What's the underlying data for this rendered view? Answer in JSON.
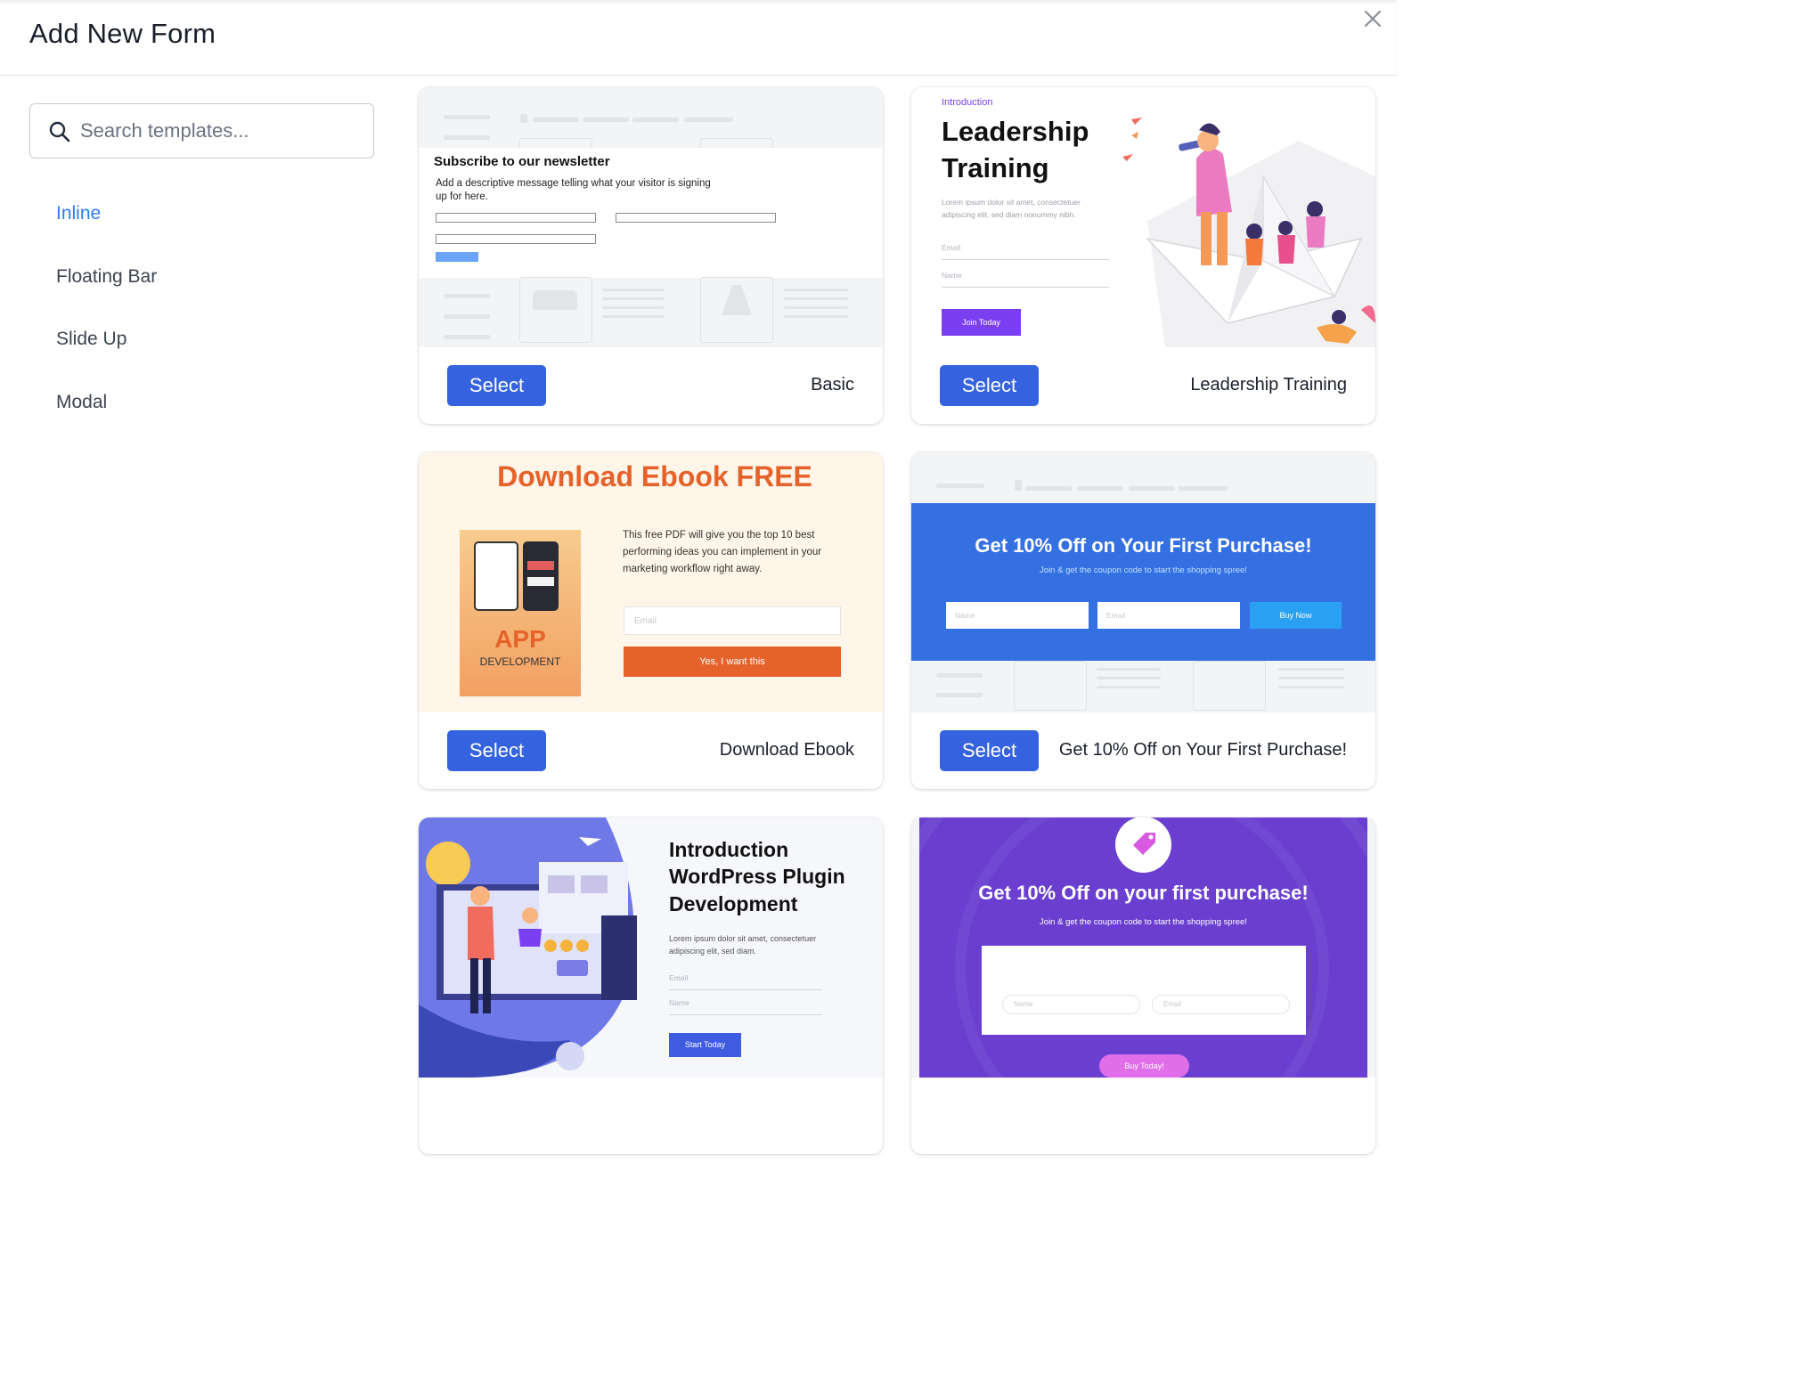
{
  "modal": {
    "title": "Add New Form",
    "close_label": "×"
  },
  "search": {
    "placeholder": "Search templates..."
  },
  "categories": [
    "Inline",
    "Floating Bar",
    "Slide Up",
    "Modal"
  ],
  "select_label": "Select",
  "templates": [
    {
      "name": "Basic",
      "preview": {
        "heading": "Subscribe to our newsletter",
        "message": "Add a descriptive message telling what your visitor is signing up for here."
      }
    },
    {
      "name": "Leadership Training",
      "preview": {
        "eyebrow": "Introduction",
        "heading_line1": "Leadership",
        "heading_line2": "Training",
        "body": "Lorem ipsum dolor sit amet, consectetuer adipiscing elit, sed diam nonummy nibh.",
        "email_label": "Email",
        "name_label": "Name",
        "button": "Join Today"
      }
    },
    {
      "name": "Download Ebook",
      "preview": {
        "heading": "Download Ebook FREE",
        "body": "This free PDF will give you the top 10 best performing ideas you can implement in your marketing workflow right away.",
        "email_placeholder": "Email",
        "button": "Yes, I want this",
        "book_title": "APP",
        "book_subtitle": "DEVELOPMENT"
      }
    },
    {
      "name": "Get 10% Off on Your First Purchase!",
      "preview": {
        "heading": "Get 10% Off on Your First Purchase!",
        "subheading": "Join & get the coupon code to start the shopping spree!",
        "name_placeholder": "Name",
        "email_placeholder": "Email",
        "button": "Buy Now"
      }
    },
    {
      "name": "",
      "preview": {
        "heading_line1": "Introduction",
        "heading_line2": "WordPress Plugin",
        "heading_line3": "Development",
        "body": "Lorem ipsum dolor sit amet, consectetuer adipiscing elit, sed diam.",
        "email_label": "Email",
        "name_label": "Name",
        "button": "Start Today"
      }
    },
    {
      "name": "",
      "preview": {
        "heading": "Get 10% Off on your first purchase!",
        "subheading": "Join & get the coupon code to start the shopping spree!",
        "name_placeholder": "Name",
        "email_placeholder": "Email",
        "button": "Buy Today!"
      }
    }
  ],
  "colors": {
    "primary": "#3563e0",
    "active_category": "#2e7cf0",
    "ebook_orange": "#e5622a",
    "promo_blue": "#3570e3",
    "promo_purple": "#6a3fd0",
    "leadership_purple": "#7b3ff2"
  }
}
